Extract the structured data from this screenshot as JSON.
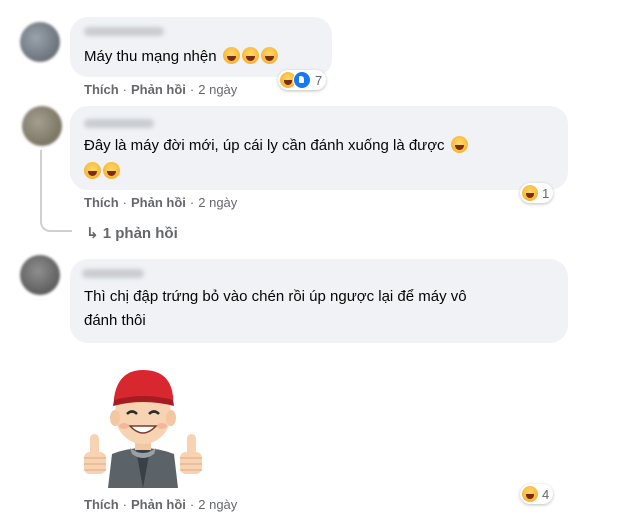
{
  "comments": [
    {
      "text": "Máy thu mạng nhện",
      "emoji": [
        "rolling-laughing-emoji",
        "rolling-laughing-emoji",
        "rolling-laughing-emoji"
      ],
      "like_label": "Thích",
      "reply_label": "Phản hồi",
      "time": "2 ngày",
      "reaction_count": "7"
    },
    {
      "text": "Đây là máy đời mới, úp cái ly cần đánh xuống là được",
      "emoji": [
        "tongue-emoji",
        "tongue-emoji",
        "tongue-emoji"
      ],
      "like_label": "Thích",
      "reply_label": "Phản hồi",
      "time": "2 ngày",
      "reaction_count": "1",
      "replies_link": "1 phản hồi"
    },
    {
      "text_line1": "Thì chị đập trứng bỏ vào chén rồi úp ngược lại để máy vô",
      "text_line2": "đánh thôi",
      "sticker": "thumbs-up-boy-sticker",
      "like_label": "Thích",
      "reply_label": "Phản hồi",
      "time": "2 ngày",
      "reaction_count": "4"
    }
  ],
  "colors": {
    "bubble": "#f0f2f5",
    "meta_text": "#65676b",
    "like_blue": "#1877f2",
    "haha_yellow": "#f7b125"
  }
}
